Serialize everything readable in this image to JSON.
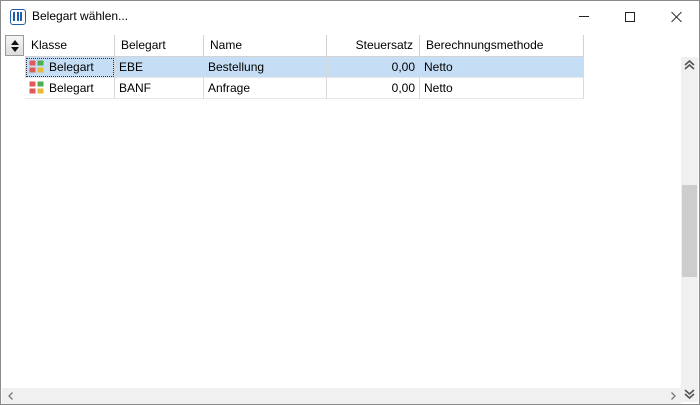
{
  "window": {
    "title": "Belegart wählen...",
    "icon": "table-icon"
  },
  "titlebar_buttons": [
    "minimize-icon",
    "maximize-icon",
    "close-icon"
  ],
  "grid": {
    "columns": [
      {
        "label": "Klasse",
        "align": "left"
      },
      {
        "label": "Belegart",
        "align": "left"
      },
      {
        "label": "Name",
        "align": "left"
      },
      {
        "label": "Steuersatz",
        "align": "right"
      },
      {
        "label": "Berechnungsmethode",
        "align": "left"
      }
    ],
    "rows": [
      {
        "klasse": "Belegart",
        "belegart": "EBE",
        "name": "Bestellung",
        "steuersatz": "0,00",
        "berechnungsmethode": "Netto",
        "selected": true
      },
      {
        "klasse": "Belegart",
        "belegart": "BANF",
        "name": "Anfrage",
        "steuersatz": "0,00",
        "berechnungsmethode": "Netto",
        "selected": false
      }
    ]
  },
  "colors": {
    "selection": "#c5def5",
    "title_icon": "#1f5fa8",
    "klasse_icon": [
      "#e05a5a",
      "#4caf50",
      "#e9b93a",
      "#e05a5a"
    ]
  }
}
